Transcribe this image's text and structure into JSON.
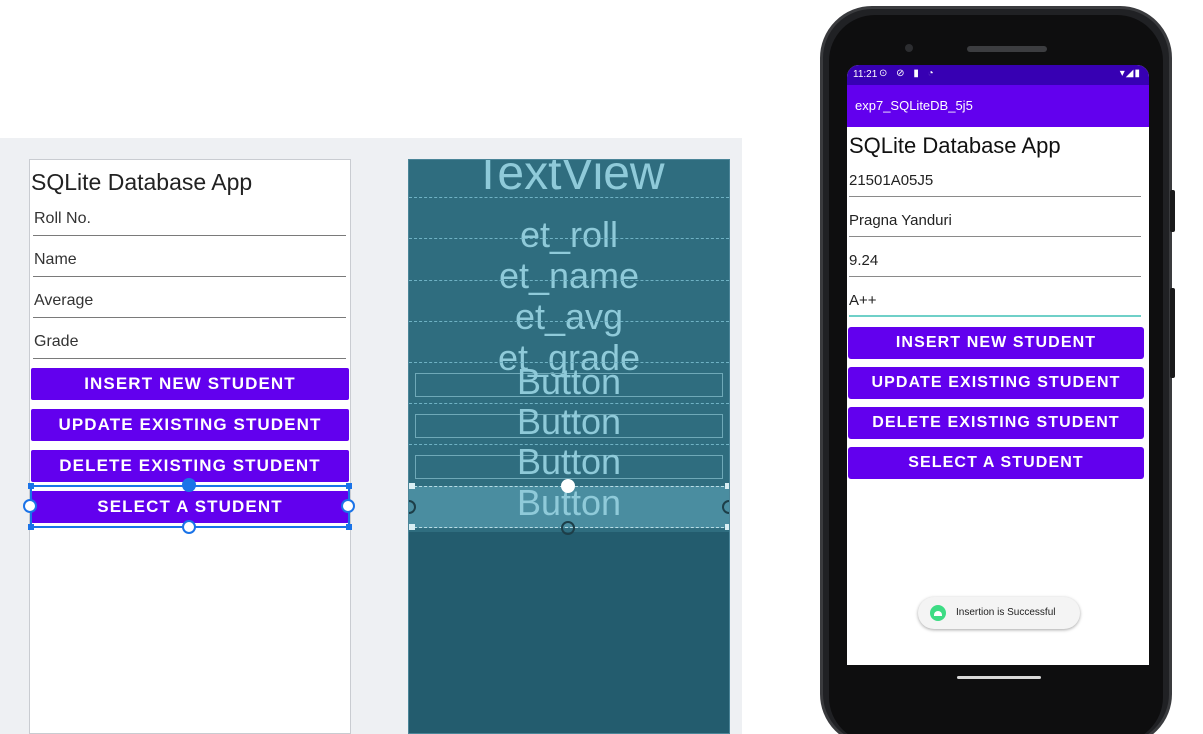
{
  "design": {
    "title": "SQLite Database App",
    "fields": [
      "Roll No.",
      "Name",
      "Average",
      "Grade"
    ],
    "buttons": [
      "INSERT NEW STUDENT",
      "UPDATE EXISTING STUDENT",
      "DELETE EXISTING STUDENT",
      "SELECT A STUDENT"
    ]
  },
  "blueprint": {
    "title_label": "TextView",
    "field_labels": [
      "et_roll",
      "et_name",
      "et_avg",
      "et_grade"
    ],
    "button_labels": [
      "Button",
      "Button",
      "Button",
      "Button"
    ]
  },
  "device": {
    "status": {
      "time": "11:21",
      "icons": "⊙ ⊘ ▮ ◔",
      "right": "▾◢▮"
    },
    "app_name": "exp7_SQLiteDB_5j5",
    "title": "SQLite Database App",
    "fields": [
      "21501A05J5",
      "Pragna Yanduri",
      "9.24",
      "A++"
    ],
    "buttons": [
      "INSERT NEW STUDENT",
      "UPDATE EXISTING STUDENT",
      "DELETE EXISTING STUDENT",
      "SELECT A STUDENT"
    ],
    "toast": "Insertion is Successful"
  },
  "colors": {
    "primary": "#6200ee",
    "primary_dark": "#3700b3",
    "blueprint_bg": "#235c6e",
    "selection_blue": "#1a73e8",
    "focus_underline": "#6fd0c8"
  }
}
